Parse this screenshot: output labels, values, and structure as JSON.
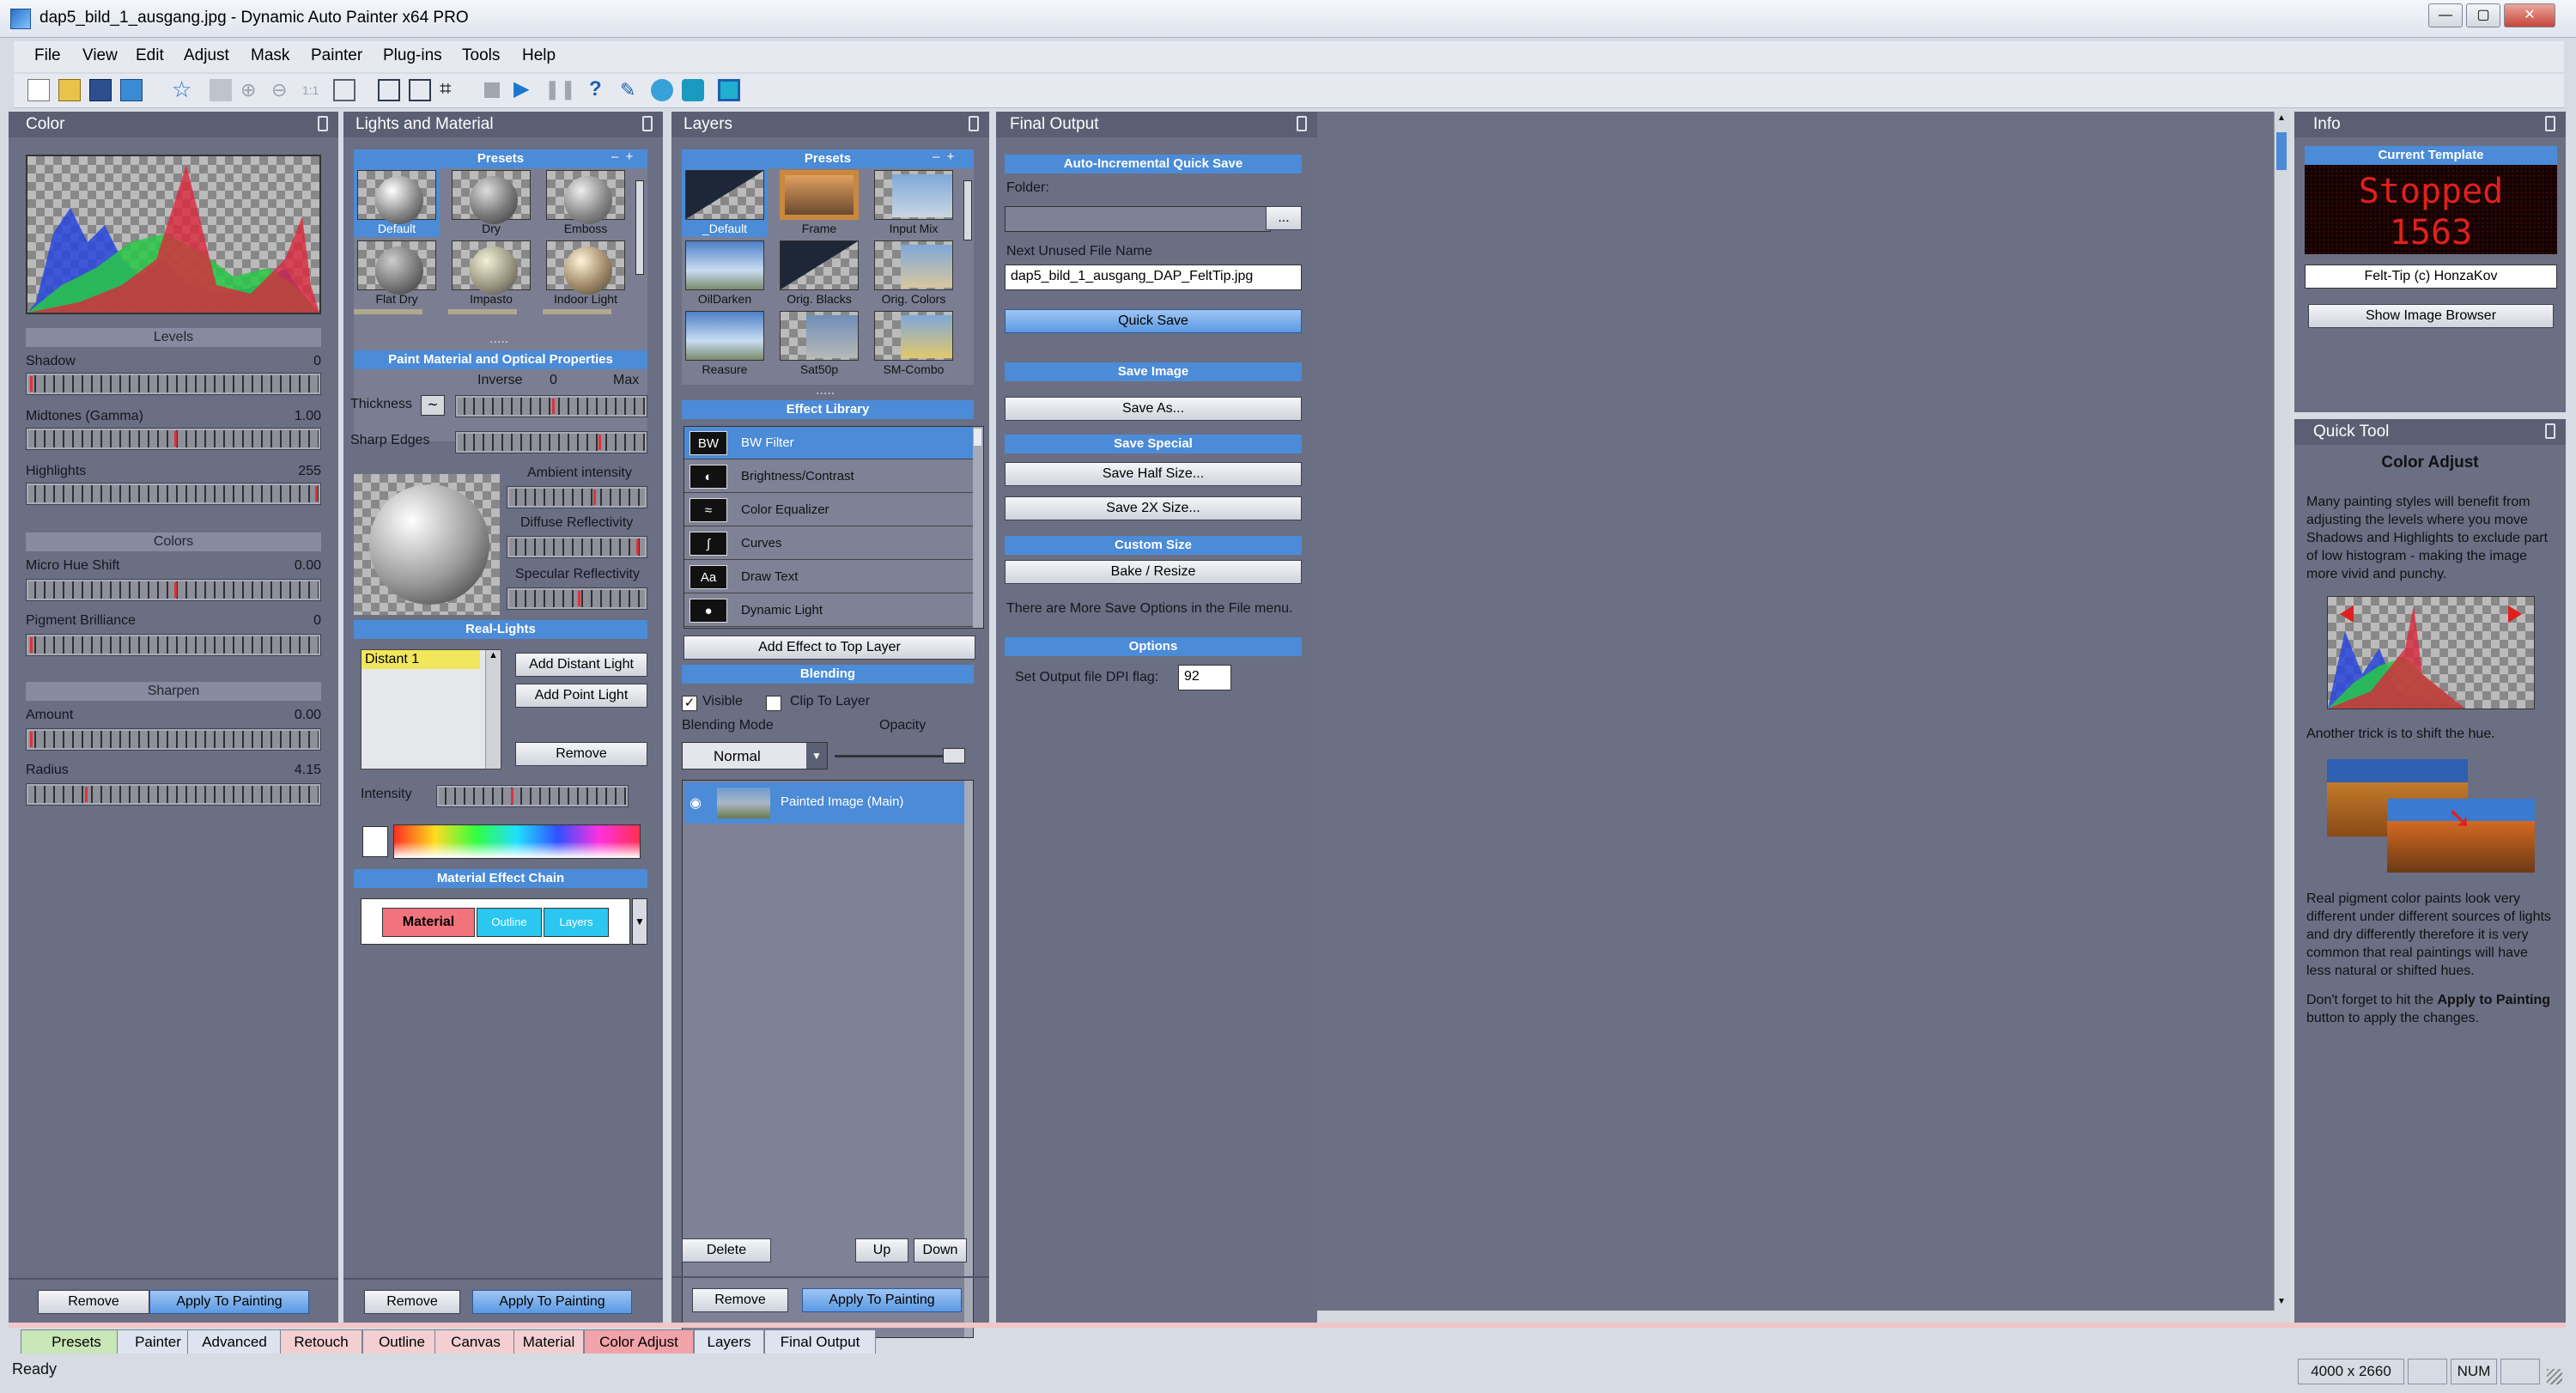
{
  "window": {
    "title": "dap5_bild_1_ausgang.jpg - Dynamic Auto Painter x64 PRO"
  },
  "menu": [
    "File",
    "View",
    "Edit",
    "Adjust",
    "Mask",
    "Painter",
    "Plug-ins",
    "Tools",
    "Help"
  ],
  "color_panel": {
    "title": "Color",
    "levels_header": "Levels",
    "shadow_label": "Shadow",
    "shadow_value": "0",
    "midtones_label": "Midtones (Gamma)",
    "midtones_value": "1.00",
    "highlights_label": "Highlights",
    "highlights_value": "255",
    "colors_header": "Colors",
    "micro_hue_label": "Micro Hue Shift",
    "micro_hue_value": "0.00",
    "pigment_label": "Pigment Brilliance",
    "pigment_value": "0",
    "sharpen_header": "Sharpen",
    "amount_label": "Amount",
    "amount_value": "0.00",
    "radius_label": "Radius",
    "radius_value": "4.15",
    "remove": "Remove",
    "apply": "Apply To Painting"
  },
  "lights_panel": {
    "title": "Lights and Material",
    "presets_header": "Presets",
    "presets": [
      "Default",
      "Dry",
      "Emboss",
      "Flat Dry",
      "Impasto",
      "Indoor Light"
    ],
    "dots": ".....",
    "paint_header": "Paint Material and Optical Properties",
    "thickness_label": "Thickness",
    "inverse_label": "Inverse",
    "zero_label": "0",
    "max_label": "Max",
    "sharp_edges_label": "Sharp Edges",
    "ambient_label": "Ambient intensity",
    "diffuse_label": "Diffuse Reflectivity",
    "specular_label": "Specular Reflectivity",
    "real_lights_header": "Real-Lights",
    "lights_list": [
      "Distant 1"
    ],
    "add_distant": "Add Distant Light",
    "add_point": "Add Point Light",
    "remove_light": "Remove",
    "intensity_label": "Intensity",
    "chain_header": "Material Effect Chain",
    "chain": [
      "Material",
      "Outline",
      "Layers"
    ],
    "remove": "Remove",
    "apply": "Apply To Painting"
  },
  "layers_panel": {
    "title": "Layers",
    "presets_header": "Presets",
    "presets": [
      "_Default",
      "Frame",
      "Input Mix",
      "OilDarken",
      "Orig. Blacks",
      "Orig. Colors",
      "Reasure",
      "Sat50p",
      "SM-Combo"
    ],
    "dots": ".....",
    "effect_header": "Effect Library",
    "effects": [
      {
        "icon": "BW",
        "label": "BW Filter"
      },
      {
        "icon": "◐",
        "label": "Brightness/Contrast"
      },
      {
        "icon": "≈",
        "label": "Color Equalizer"
      },
      {
        "icon": "∫",
        "label": "Curves"
      },
      {
        "icon": "Aa",
        "label": "Draw Text"
      },
      {
        "icon": "●",
        "label": "Dynamic Light"
      }
    ],
    "add_effect": "Add Effect to Top Layer",
    "blending_header": "Blending",
    "visible_label": "Visible",
    "clip_label": "Clip To Layer",
    "blend_mode_label": "Blending Mode",
    "opacity_label": "Opacity",
    "blend_mode_value": "Normal",
    "layer_name": "Painted Image (Main)",
    "delete": "Delete",
    "up": "Up",
    "down": "Down",
    "remove": "Remove",
    "apply": "Apply To Painting"
  },
  "final_panel": {
    "title": "Final Output",
    "quick_save_header": "Auto-Incremental Quick Save",
    "folder_label": "Folder:",
    "folder_value": "",
    "browse": "...",
    "next_label": "Next Unused File Name",
    "next_value": "dap5_bild_1_ausgang_DAP_FeltTip.jpg",
    "quick_save": "Quick Save",
    "save_image_header": "Save Image",
    "save_as": "Save As...",
    "save_special_header": "Save Special",
    "save_half": "Save Half Size...",
    "save_2x": "Save 2X Size...",
    "custom_header": "Custom Size",
    "bake": "Bake / Resize",
    "more_options": "There are More Save Options in the File menu.",
    "options_header": "Options",
    "dpi_label": "Set Output file DPI flag:",
    "dpi_value": "92"
  },
  "info_panel": {
    "title": "Info",
    "template_header": "Current Template",
    "led_line1": "Stopped",
    "led_line2": "1563",
    "template_name": "Felt-Tip (c) HonzaKov",
    "show_browser": "Show Image Browser"
  },
  "quick_tool": {
    "title": "Quick Tool",
    "heading": "Color Adjust",
    "para1": "Many painting styles will benefit from adjusting the levels where you move Shadows and Highlights to exclude part of low histogram - making the image more vivid and punchy.",
    "para2": "Another trick is to shift the hue.",
    "para3": "Real pigment color paints look very different under different sources of lights and dry differently therefore it is very common that real paintings will have less natural or shifted hues.",
    "para4_pre": "Don't forget to hit the ",
    "para4_bold1": "Apply to Painting",
    "para4_post": " button to apply the changes."
  },
  "tabs": [
    "Presets",
    "Painter",
    "Advanced",
    "Retouch",
    "Outline",
    "Canvas",
    "Material",
    "Color Adjust",
    "Layers",
    "Final Output"
  ],
  "status": {
    "ready": "Ready",
    "size": "4000 x 2660",
    "num": "NUM"
  }
}
